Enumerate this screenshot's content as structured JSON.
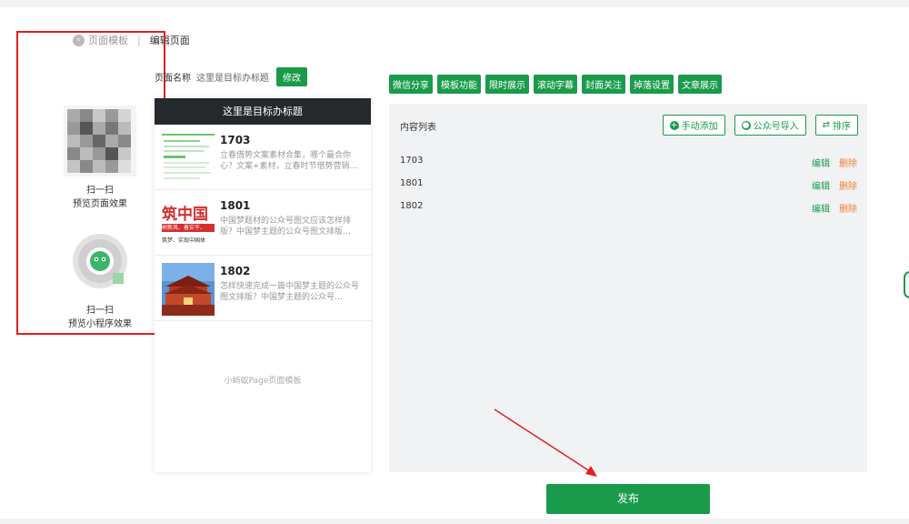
{
  "breadcrumb": {
    "back": "页面模板",
    "current": "编辑页面"
  },
  "qr": [
    {
      "line1": "扫一扫",
      "line2": "预览页面效果"
    },
    {
      "line1": "扫一扫",
      "line2": "预览小程序效果"
    }
  ],
  "page_name": {
    "label": "页面名称",
    "value": "这里是目标办标题",
    "edit_button": "修改"
  },
  "phone": {
    "header": "这里是目标办标题",
    "footer": "小蚂蚁Page页面模板",
    "articles": [
      {
        "title": "1703",
        "desc": "立春借势文案素材合集，哪个最合你心？文案+素材，立春时节借势营销…"
      },
      {
        "title": "1801",
        "desc": "中国梦题材的公众号图文应该怎样排版？中国梦主题的公众号图文排版…"
      },
      {
        "title": "1802",
        "desc": "怎样快速完成一篇中国梦主题的公众号图文排版？中国梦主题的公众号…"
      }
    ]
  },
  "thumb_text": {
    "big": "筑中国",
    "line1": "树新风、着实干、",
    "line2": "筑梦、实现中国体"
  },
  "tabs": [
    "微信分享",
    "模板功能",
    "限时展示",
    "滚动字幕",
    "封面关注",
    "掉落设置",
    "文章展示"
  ],
  "content_list": {
    "title": "内容列表",
    "manual_add": "手动添加",
    "import_official": "公众号导入",
    "sort": "排序",
    "rows": [
      {
        "name": "1703",
        "edit": "编辑",
        "delete": "删除"
      },
      {
        "name": "1801",
        "edit": "编辑",
        "delete": "删除"
      },
      {
        "name": "1802",
        "edit": "编辑",
        "delete": "删除"
      }
    ]
  },
  "publish": "发布",
  "colors": {
    "accent": "#1a9b4b",
    "delete": "#f08030",
    "highlight": "#e02020",
    "header": "#24292e"
  }
}
